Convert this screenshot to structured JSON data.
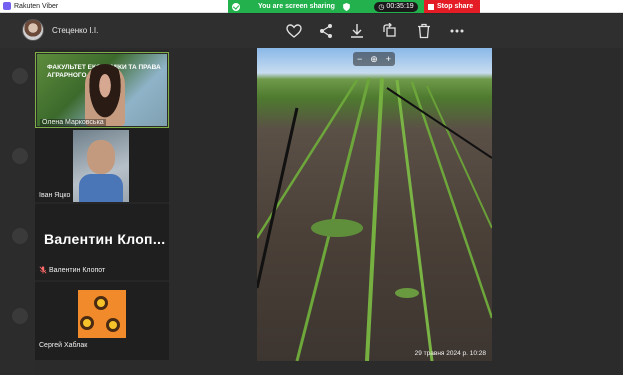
{
  "window": {
    "title": "Rakuten Viber"
  },
  "sharing": {
    "status": "You are screen sharing",
    "timer": "00:35:19",
    "stop_label": "Stop share"
  },
  "chat": {
    "contact_name": "Стеценко І.І."
  },
  "toolbar": {
    "icons": [
      "heart-icon",
      "share-icon",
      "download-icon",
      "rotate-icon",
      "trash-icon",
      "more-icon"
    ]
  },
  "participants": [
    {
      "name": "Олена Марковська",
      "banner": "ФАКУЛЬТЕТ ЕКОНОМІКИ ТА ПРАВА АГРАРНОГО БІЗНЕСУ"
    },
    {
      "name": "Іван Яцко"
    },
    {
      "name": "Валентин Клопот",
      "display_name": "Валентин  Клоп...",
      "muted": true
    },
    {
      "name": "Сергей Хаблак"
    }
  ],
  "viewer": {
    "zoom_minus": "−",
    "zoom_plus": "+",
    "timestamp": "29 травня 2024 р. 10:28"
  },
  "colors": {
    "sharing_green": "#22b14c",
    "stop_red": "#e31c25",
    "active_tile_border": "#7fb048"
  }
}
